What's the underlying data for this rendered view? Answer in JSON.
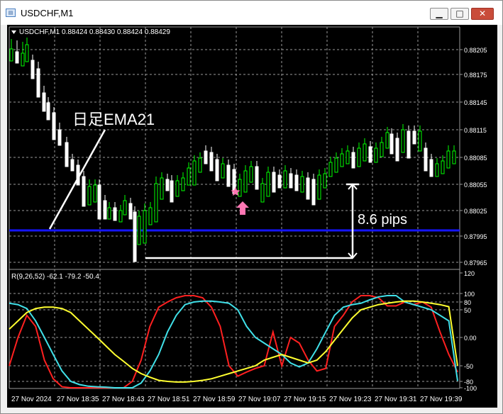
{
  "window": {
    "title": "USDCHF,M1",
    "icon": "chart-window-icon",
    "controls": {
      "minimize": "minimize-icon",
      "maximize": "maximize-icon",
      "close": "close-icon"
    }
  },
  "chart": {
    "header": "USDCHF,M1  0.88424 0.88430 0.88424 0.88429",
    "price_ticks": [
      "0.88205",
      "0.88175",
      "0.88145",
      "0.88115",
      "0.88085",
      "0.88055",
      "0.88025",
      "0.87995",
      "0.87965"
    ],
    "time_ticks": [
      "27 Nov 2024",
      "27 Nov 18:35",
      "27 Nov 18:43",
      "27 Nov 18:51",
      "27 Nov 18:59",
      "27 Nov 19:07",
      "27 Nov 19:15",
      "27 Nov 19:23",
      "27 Nov 19:31",
      "27 Nov 19:39"
    ],
    "annotation_ema": "日足EMA21",
    "annotation_pips": "8.6 pips",
    "ema_level": 0.88005,
    "signal_star_icon": "star-icon",
    "signal_arrow_icon": "up-arrow-icon",
    "colors": {
      "background": "#000000",
      "grid": "#9a9a9a",
      "bull": "#00ff00",
      "bear": "#ffffff",
      "ema_line": "#0000ff",
      "indicator_red": "#ff2020",
      "indicator_cyan": "#40e0e8",
      "indicator_yellow": "#ffff30",
      "signal": "#ff77b4"
    }
  },
  "indicator": {
    "label": "R(9,26,52) -62.1 -79.2 -50.4",
    "ticks": [
      "120",
      "100",
      "80",
      "50",
      "0.00",
      "-50",
      "-80",
      "-100"
    ]
  },
  "chart_data": {
    "type": "line",
    "title": "",
    "xlabel": "",
    "ylabel": "",
    "ylim": [
      -120,
      120
    ],
    "series": [
      {
        "values": [
          -50,
          0,
          40,
          20,
          -40,
          -75,
          -97,
          -100,
          -100,
          -100,
          -100,
          -100,
          -100,
          -100,
          -80,
          -40,
          20,
          60,
          80,
          90,
          95,
          95,
          90,
          60,
          20,
          -50,
          -70,
          -62,
          -55,
          -50,
          10,
          -50,
          0,
          -10,
          -40,
          -60,
          -55,
          20,
          40,
          80,
          95,
          95,
          90,
          65,
          65,
          80,
          70,
          80,
          60,
          10,
          -30,
          -62
        ]
      },
      {
        "values": [
          75,
          70,
          55,
          30,
          0,
          -30,
          -60,
          -80,
          -90,
          -95,
          -97,
          -98,
          -100,
          -100,
          -100,
          -85,
          -60,
          -30,
          10,
          40,
          70,
          80,
          82,
          82,
          80,
          75,
          50,
          20,
          0,
          -10,
          -20,
          -30,
          -45,
          -52,
          -45,
          -20,
          10,
          40,
          60,
          70,
          75,
          85,
          92,
          95,
          95,
          80,
          70,
          60,
          50,
          40,
          30,
          -79
        ]
      },
      {
        "values": [
          15,
          30,
          45,
          55,
          60,
          60,
          55,
          45,
          30,
          15,
          0,
          -15,
          -30,
          -42,
          -55,
          -65,
          -72,
          -78,
          -80,
          -82,
          -82,
          -80,
          -78,
          -75,
          -70,
          -65,
          -60,
          -55,
          -50,
          -40,
          -35,
          -30,
          -35,
          -40,
          -45,
          -40,
          -25,
          -5,
          15,
          35,
          50,
          60,
          70,
          75,
          80,
          82,
          82,
          80,
          75,
          70,
          62,
          -50
        ]
      }
    ]
  }
}
